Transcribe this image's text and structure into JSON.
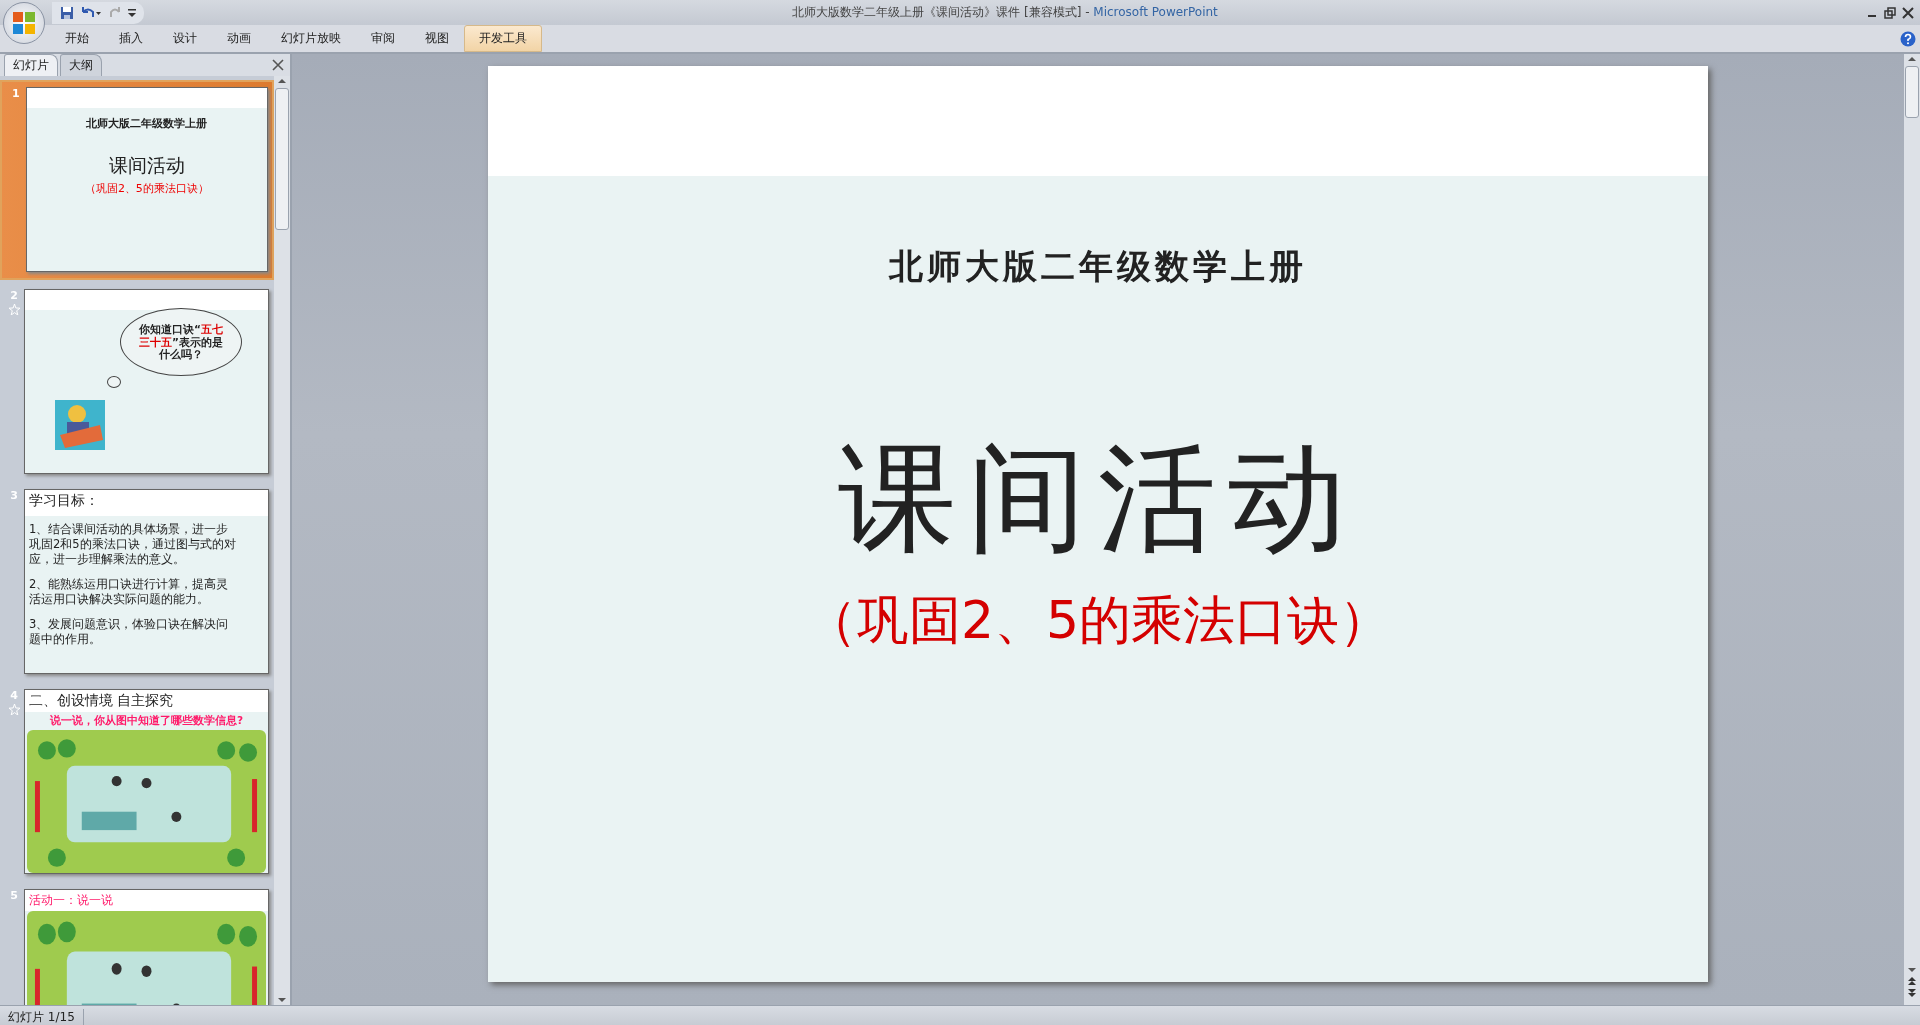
{
  "window": {
    "title": "北师大版数学二年级上册《课间活动》课件 [兼容模式] - ",
    "app_name": "Microsoft PowerPoint"
  },
  "ribbon_tabs": [
    {
      "label": "开始",
      "selected": false
    },
    {
      "label": "插入",
      "selected": false
    },
    {
      "label": "设计",
      "selected": false
    },
    {
      "label": "动画",
      "selected": false
    },
    {
      "label": "幻灯片放映",
      "selected": false
    },
    {
      "label": "审阅",
      "selected": false
    },
    {
      "label": "视图",
      "selected": false
    },
    {
      "label": "开发工具",
      "selected": true
    }
  ],
  "pane_tabs": [
    {
      "label": "幻灯片",
      "selected": true
    },
    {
      "label": "大纲",
      "selected": false
    }
  ],
  "thumbnails": [
    {
      "number": "1",
      "selected": true,
      "animated": false,
      "kind": "title",
      "heading": "北师大版二年级数学上册",
      "title": "课间活动",
      "subtitle": "（巩固2、5的乘法口诀）"
    },
    {
      "number": "2",
      "selected": false,
      "animated": true,
      "kind": "bubble",
      "segments": [
        {
          "text": "你知道口诀“",
          "highlight": false
        },
        {
          "text": "五七三十五",
          "highlight": true
        },
        {
          "text": "”表示的是什么吗？",
          "highlight": false
        }
      ]
    },
    {
      "number": "3",
      "selected": false,
      "animated": false,
      "kind": "objectives",
      "heading": "学习目标：",
      "items": [
        "1、结合课间活动的具体场景，进一步巩固2和5的乘法口诀，通过图与式的对应，进一步理解乘法的意义。",
        "2、能熟练运用口诀进行计算，提高灵活运用口诀解决实际问题的能力。",
        "3、发展问题意识，体验口诀在解决问题中的作用。"
      ]
    },
    {
      "number": "4",
      "selected": false,
      "animated": true,
      "kind": "scene",
      "heading": "二、创设情境 自主探究",
      "question": "说一说，你从图中知道了哪些数学信息?"
    },
    {
      "number": "5",
      "selected": false,
      "animated": false,
      "kind": "scene",
      "heading": "活动一：说一说"
    }
  ],
  "slide": {
    "heading": "北师大版二年级数学上册",
    "title": "课间活动",
    "subtitle": "（巩固2、5的乘法口诀）"
  },
  "status_bar": {
    "slide_indicator": "幻灯片 1/15"
  }
}
